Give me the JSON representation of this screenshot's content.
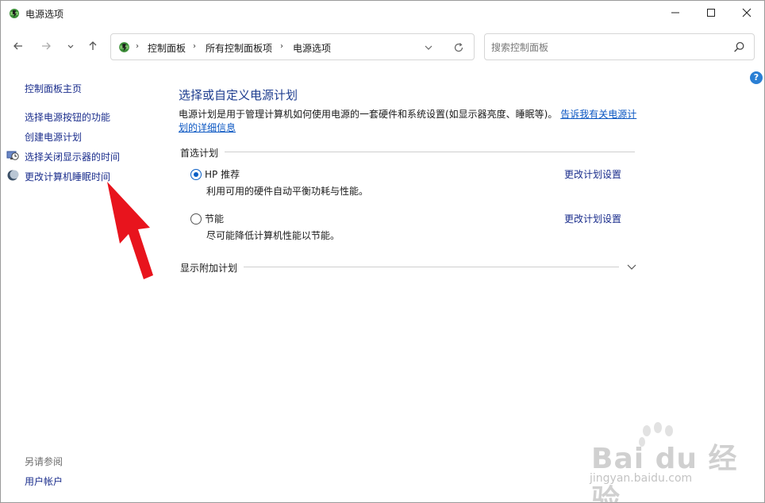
{
  "window": {
    "title": "电源选项",
    "controls": {
      "minimize": "minimize-icon",
      "maximize": "maximize-icon",
      "close": "close-icon"
    }
  },
  "nav": {
    "breadcrumb": [
      "控制面板",
      "所有控制面板项",
      "电源选项"
    ],
    "search_placeholder": "搜索控制面板"
  },
  "left_pane": {
    "links": [
      {
        "label": "控制面板主页",
        "icon": ""
      },
      {
        "label": "选择电源按钮的功能",
        "icon": ""
      },
      {
        "label": "创建电源计划",
        "icon": ""
      },
      {
        "label": "选择关闭显示器的时间",
        "icon": "monitor-clock-icon"
      },
      {
        "label": "更改计算机睡眠时间",
        "icon": "moon-icon"
      }
    ],
    "see_also_label": "另请参阅",
    "see_also_links": [
      "用户帐户"
    ]
  },
  "main": {
    "heading": "选择或自定义电源计划",
    "description": "电源计划是用于管理计算机如何使用电源的一套硬件和系统设置(如显示器亮度、睡眠等)。",
    "description_link": "告诉我有关电源计划的详细信息",
    "preferred_label": "首选计划",
    "plans": [
      {
        "name": "HP 推荐",
        "description": "利用可用的硬件自动平衡功耗与性能。",
        "change_link": "更改计划设置",
        "selected": true
      },
      {
        "name": "节能",
        "description": "尽可能降低计算机性能以节能。",
        "change_link": "更改计划设置",
        "selected": false
      }
    ],
    "show_more_label": "显示附加计划"
  },
  "watermark": {
    "brand": "Bai du 经验",
    "url": "jingyan.baidu.com"
  },
  "colors": {
    "link": "#1a2d8c",
    "heading": "#1d3c8f",
    "radio_accent": "#0a5fc6",
    "arrow": "#e8141d",
    "help_icon": "#2a7fd4"
  }
}
